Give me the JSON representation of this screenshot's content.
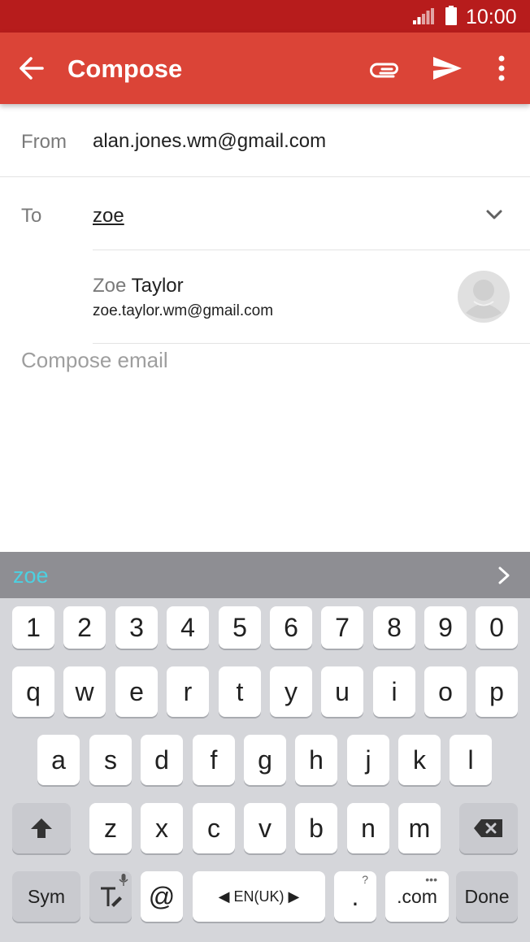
{
  "status_bar": {
    "time": "10:00"
  },
  "app_bar": {
    "title": "Compose"
  },
  "from": {
    "label": "From",
    "value": "alan.jones.wm@gmail.com"
  },
  "to": {
    "label": "To",
    "value": "zoe"
  },
  "suggestion": {
    "name_match": "Zoe",
    "name_rest": " Taylor",
    "email": "zoe.taylor.wm@gmail.com"
  },
  "compose": {
    "placeholder": "Compose email"
  },
  "prediction": {
    "word": "zoe"
  },
  "keyboard": {
    "row_numbers": [
      "1",
      "2",
      "3",
      "4",
      "5",
      "6",
      "7",
      "8",
      "9",
      "0"
    ],
    "row1": [
      "q",
      "w",
      "e",
      "r",
      "t",
      "y",
      "u",
      "i",
      "o",
      "p"
    ],
    "row2": [
      "a",
      "s",
      "d",
      "f",
      "g",
      "h",
      "j",
      "k",
      "l"
    ],
    "row3": [
      "z",
      "x",
      "c",
      "v",
      "b",
      "n",
      "m"
    ],
    "sym": "Sym",
    "at": "@",
    "language": "EN(UK)",
    "period": ".",
    "period_hint": "?",
    "dotcom": ".com",
    "done": "Done"
  },
  "colors": {
    "status_bar": "#b71c1c",
    "app_bar": "#db4437",
    "prediction_word": "#4dd0e1"
  },
  "icons": [
    "signal-icon",
    "battery-icon",
    "back-arrow-icon",
    "attach-icon",
    "send-icon",
    "more-vert-icon",
    "chevron-down-icon",
    "contact-avatar-icon",
    "chevron-right-icon",
    "shift-icon",
    "backspace-icon",
    "text-mode-icon",
    "mic-icon"
  ]
}
